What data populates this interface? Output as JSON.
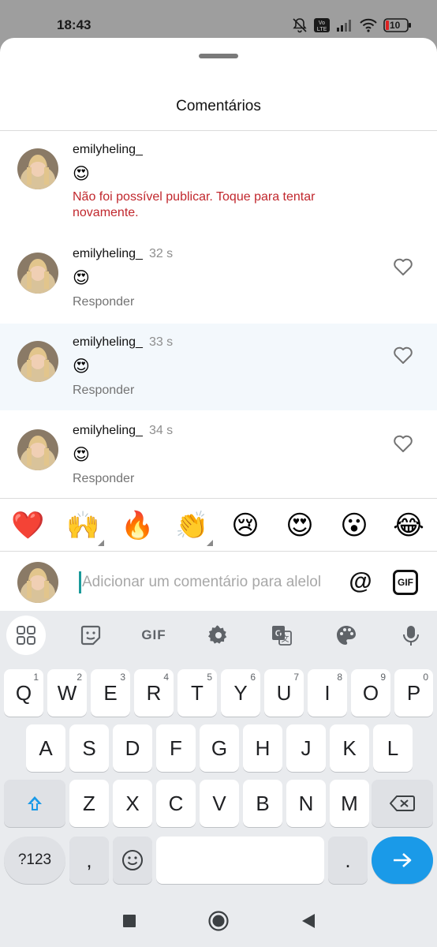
{
  "status": {
    "time": "18:43",
    "battery": "10",
    "volte": "Vo LTE"
  },
  "sheet": {
    "title": "Comentários"
  },
  "comments": [
    {
      "user": "emilyheling_",
      "time": "",
      "emoji": "😍",
      "error": "Não foi possível publicar. Toque para tentar novamente.",
      "reply": ""
    },
    {
      "user": "emilyheling_",
      "time": "32 s",
      "emoji": "😍",
      "error": "",
      "reply": "Responder"
    },
    {
      "user": "emilyheling_",
      "time": "33 s",
      "emoji": "😍",
      "error": "",
      "reply": "Responder"
    },
    {
      "user": "emilyheling_",
      "time": "34 s",
      "emoji": "😍",
      "error": "",
      "reply": "Responder"
    }
  ],
  "quick_reactions": [
    "❤️",
    "🙌",
    "🔥",
    "👏",
    "😢",
    "😍",
    "😮",
    "😂"
  ],
  "composer": {
    "placeholder": "Adicionar um comentário para alelol",
    "mention": "@",
    "gif": "GIF"
  },
  "keyboard": {
    "toolbar": {
      "gif": "GIF"
    },
    "row1": [
      {
        "k": "Q",
        "h": "1"
      },
      {
        "k": "W",
        "h": "2"
      },
      {
        "k": "E",
        "h": "3"
      },
      {
        "k": "R",
        "h": "4"
      },
      {
        "k": "T",
        "h": "5"
      },
      {
        "k": "Y",
        "h": "6"
      },
      {
        "k": "U",
        "h": "7"
      },
      {
        "k": "I",
        "h": "8"
      },
      {
        "k": "O",
        "h": "9"
      },
      {
        "k": "P",
        "h": "0"
      }
    ],
    "row2": [
      "A",
      "S",
      "D",
      "F",
      "G",
      "H",
      "J",
      "K",
      "L"
    ],
    "row3": [
      "Z",
      "X",
      "C",
      "V",
      "B",
      "N",
      "M"
    ],
    "symbols": "?123",
    "comma": ",",
    "period": "."
  },
  "colors": {
    "accent": "#1a9ae8",
    "error": "#c1272d",
    "highlight": "#f3f8fc"
  }
}
